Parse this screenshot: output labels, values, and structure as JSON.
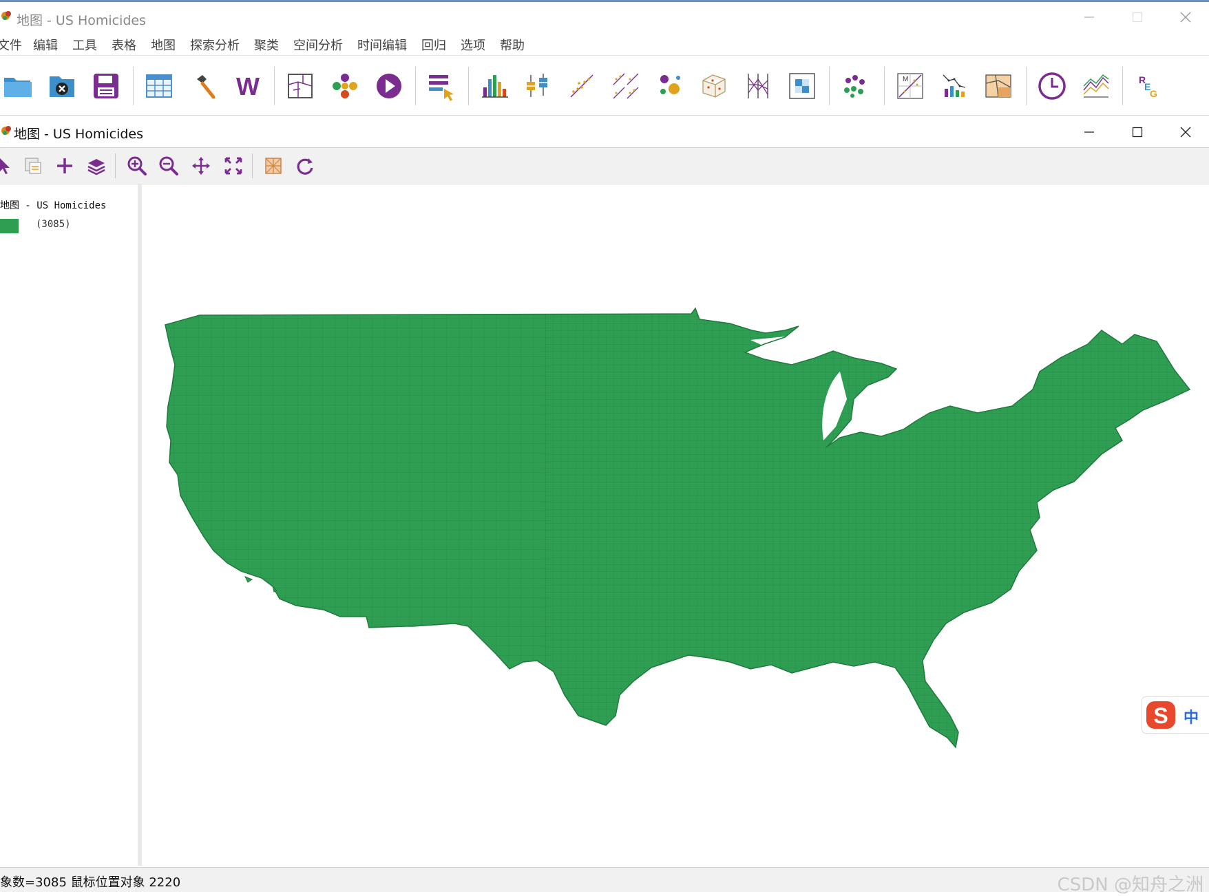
{
  "window": {
    "title": "地图 - US Homicides",
    "controls": {
      "minimize": "minimize",
      "maximize": "maximize",
      "close": "close"
    }
  },
  "menu": [
    "文件",
    "编辑",
    "工具",
    "表格",
    "地图",
    "探索分析",
    "聚类",
    "空间分析",
    "时间编辑",
    "回归",
    "选项",
    "帮助"
  ],
  "toolbar_icons": [
    "open-folder-icon",
    "close-project-icon",
    "save-icon",
    "table-icon",
    "hammer-tool-icon",
    "weights-icon",
    "map-icon",
    "cartogram-icon",
    "map-animation-icon",
    "select-category-icon",
    "histogram-icon",
    "boxplot-icon",
    "scatter-plot-icon",
    "scatter-matrix-icon",
    "bubble-chart-icon",
    "3d-scatter-icon",
    "parallel-coordinates-icon",
    "conditional-plot-icon",
    "cluster-icon",
    "moran-scatter-icon",
    "lisa-icon",
    "spatial-correlogram-icon",
    "time-editor-icon",
    "averages-chart-icon",
    "regression-icon"
  ],
  "map_window": {
    "title": "地图 - US Homicides",
    "tools": [
      "select-pointer-icon",
      "selectable-layer-icon",
      "add-layer-icon",
      "layers-icon",
      "zoom-in-icon",
      "zoom-out-icon",
      "pan-icon",
      "full-extent-icon",
      "basemap-icon",
      "refresh-icon"
    ]
  },
  "legend": {
    "title": "地图 - US Homicides",
    "count_label": "(3085)",
    "swatch_color": "#2e9e52"
  },
  "map": {
    "fill_color": "#2e9e52",
    "border_color": "#1f7a3c"
  },
  "status": {
    "text": "象数=3085 鼠标位置对象 2220",
    "watermark": "CSDN @知舟之洲"
  },
  "ime": {
    "label": "中"
  }
}
